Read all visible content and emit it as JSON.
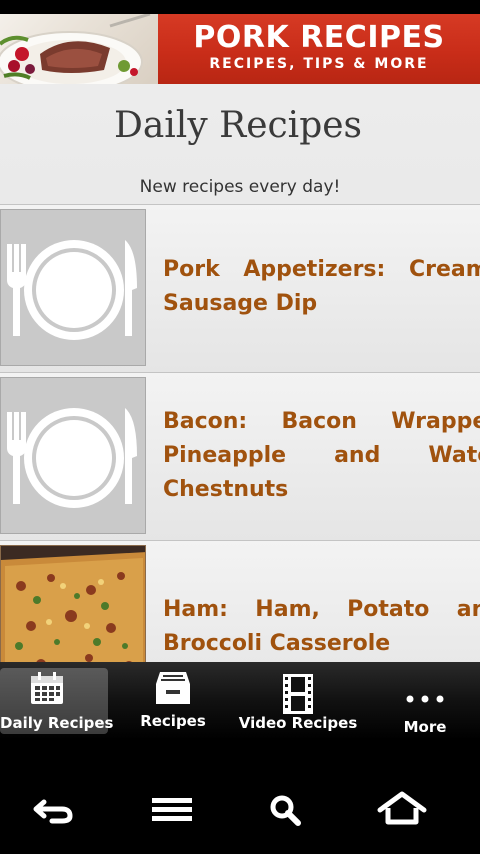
{
  "banner": {
    "title": "PORK RECIPES",
    "subtitle": "RECIPES, TIPS & MORE"
  },
  "page": {
    "title": "Daily Recipes",
    "tagline": "New recipes every day!"
  },
  "recipes": [
    {
      "title": "Pork Appetizers: Creamy Sausage Dip",
      "thumb": "plate-icon"
    },
    {
      "title": "Bacon: Bacon Wrapped Pineapple and Water Chestnuts",
      "thumb": "plate-icon"
    },
    {
      "title": "Ham: Ham, Potato and Broccoli Casserole",
      "thumb": "casserole-photo"
    }
  ],
  "tabs": [
    {
      "label": "Daily Recipes",
      "icon": "calendar-icon",
      "active": true
    },
    {
      "label": "Recipes",
      "icon": "archive-box-icon",
      "active": false
    },
    {
      "label": "Video Recipes",
      "icon": "film-icon",
      "active": false
    },
    {
      "label": "More",
      "icon": "more-dots-icon",
      "active": false
    }
  ],
  "system_nav": [
    "back-icon",
    "menu-icon",
    "search-icon",
    "home-icon"
  ],
  "colors": {
    "banner_red": "#c92d19",
    "recipe_title": "#a0520e",
    "tabbar": "#111111"
  }
}
